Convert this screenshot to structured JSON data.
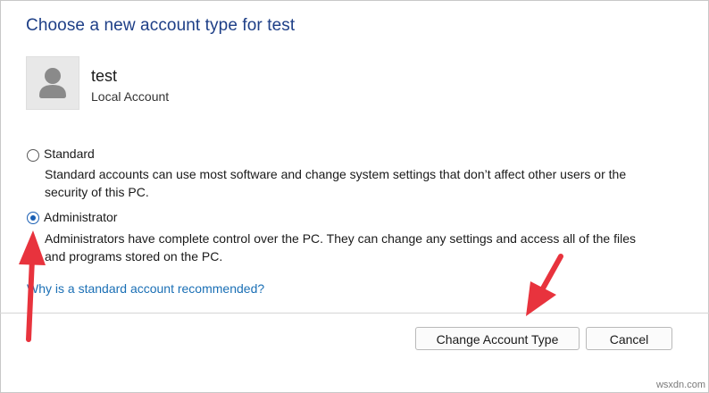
{
  "dialog": {
    "title": "Choose a new account type for test"
  },
  "user": {
    "name": "test",
    "account_kind": "Local Account",
    "avatar_icon": "person-icon"
  },
  "options": [
    {
      "label": "Standard",
      "description_line1": "Standard accounts can use most software and change system settings that don’t affect other users or the",
      "description_line2": "security of this PC.",
      "selected": false
    },
    {
      "label": "Administrator",
      "description_line1": "Administrators have complete control over the PC. They can change any settings and access all of the files",
      "description_line2": "and programs stored on the PC.",
      "selected": true
    }
  ],
  "help_link": "Why is a standard account recommended?",
  "buttons": {
    "change_account_type": "Change Account Type",
    "cancel": "Cancel"
  },
  "annotations": {
    "arrow_color": "#e8333d"
  },
  "watermark": "wsxdn.com",
  "colors": {
    "title": "#1e3f87",
    "link": "#1a6fb5",
    "radio_selected": "#1a5fb4"
  }
}
